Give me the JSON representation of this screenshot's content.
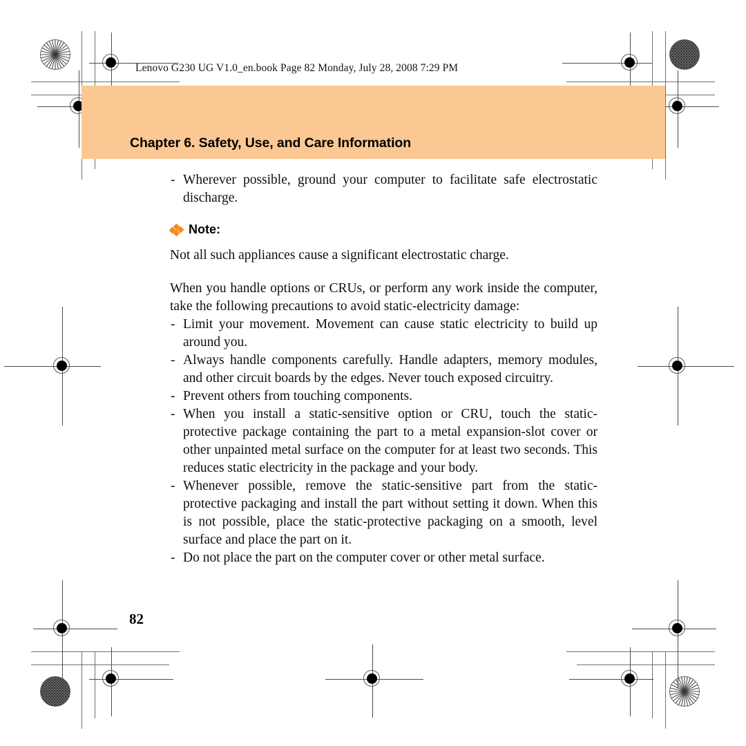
{
  "header": {
    "book_line": "Lenovo G230 UG V1.0_en.book  Page 82  Monday, July 28, 2008  7:29 PM"
  },
  "chapter": {
    "band_color": "#fbc893",
    "title": "Chapter 6. Safety, Use, and Care Information"
  },
  "body": {
    "lead_bullet": "Wherever possible, ground your computer to facilitate safe electrostatic discharge.",
    "note": {
      "label": "Note:",
      "icon_color": "#f5881f",
      "text": "Not all such appliances cause a significant electrostatic charge."
    },
    "intro_paragraph": "When you handle options or CRUs, or perform any work inside the computer, take the following precautions to avoid static-electricity damage:",
    "bullets": [
      "Limit your movement. Movement can cause static electricity to build up around you.",
      "Always handle components carefully. Handle adapters, memory modules, and other circuit boards by the edges. Never touch exposed circuitry.",
      "Prevent others from touching components.",
      "When you install a static-sensitive option or CRU, touch the static-protective package containing the part to a metal expansion-slot cover or other unpainted metal surface on the computer for at least two seconds. This reduces static electricity in the package and your body.",
      "Whenever possible, remove the static-sensitive part from the static-protective packaging and install the part without setting it down. When this is not possible, place the static-protective packaging on a smooth, level surface and place the part on it.",
      "Do not place the part on the computer cover or other metal surface."
    ],
    "dash_marker": "-"
  },
  "footer": {
    "page_number": "82"
  }
}
